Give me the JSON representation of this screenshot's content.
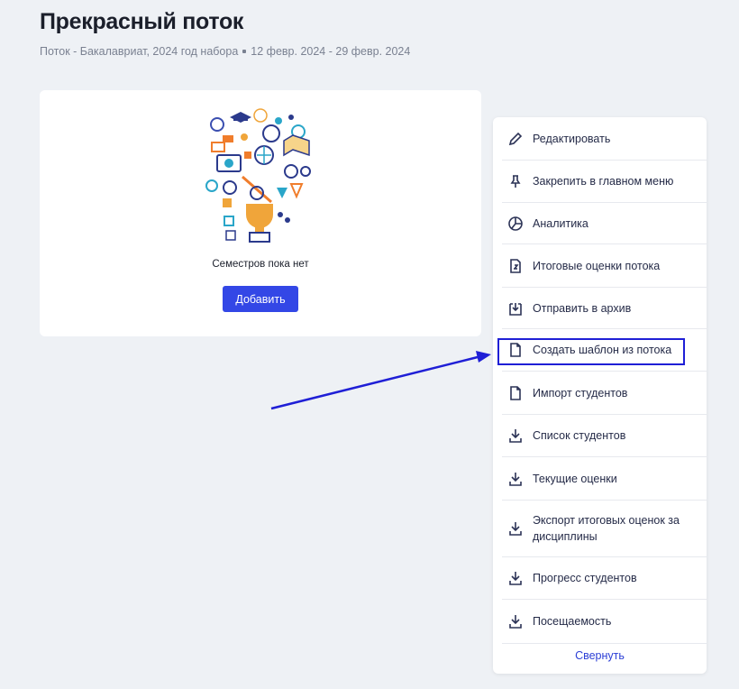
{
  "header": {
    "title": "Прекрасный поток",
    "subtitle_type": "Поток - Бакалавриат, 2024 год набора",
    "subtitle_dates": "12 февр. 2024 - 29 февр. 2024"
  },
  "semesters": {
    "empty_text": "Семестров пока нет",
    "add_label": "Добавить"
  },
  "menu": {
    "items": [
      {
        "label": "Редактировать",
        "icon": "pencil-icon"
      },
      {
        "label": "Закрепить в главном меню",
        "icon": "pin-icon"
      },
      {
        "label": "Аналитика",
        "icon": "pie-chart-icon"
      },
      {
        "label": "Итоговые оценки потока",
        "icon": "grade-document-icon"
      },
      {
        "label": "Отправить в архив",
        "icon": "archive-icon"
      },
      {
        "label": "Создать шаблон из потока",
        "icon": "document-icon"
      },
      {
        "label": "Импорт студентов",
        "icon": "document-icon"
      },
      {
        "label": "Список студентов",
        "icon": "download-icon"
      },
      {
        "label": "Текущие оценки",
        "icon": "download-icon"
      },
      {
        "label": "Экспорт итоговых оценок за дисциплины",
        "icon": "download-icon"
      },
      {
        "label": "Прогресс студентов",
        "icon": "download-icon"
      },
      {
        "label": "Посещаемость",
        "icon": "download-icon"
      }
    ],
    "collapse_label": "Свернуть"
  },
  "colors": {
    "accent": "#3347e6",
    "highlight": "#1f1fd6",
    "background": "#eef1f5"
  }
}
